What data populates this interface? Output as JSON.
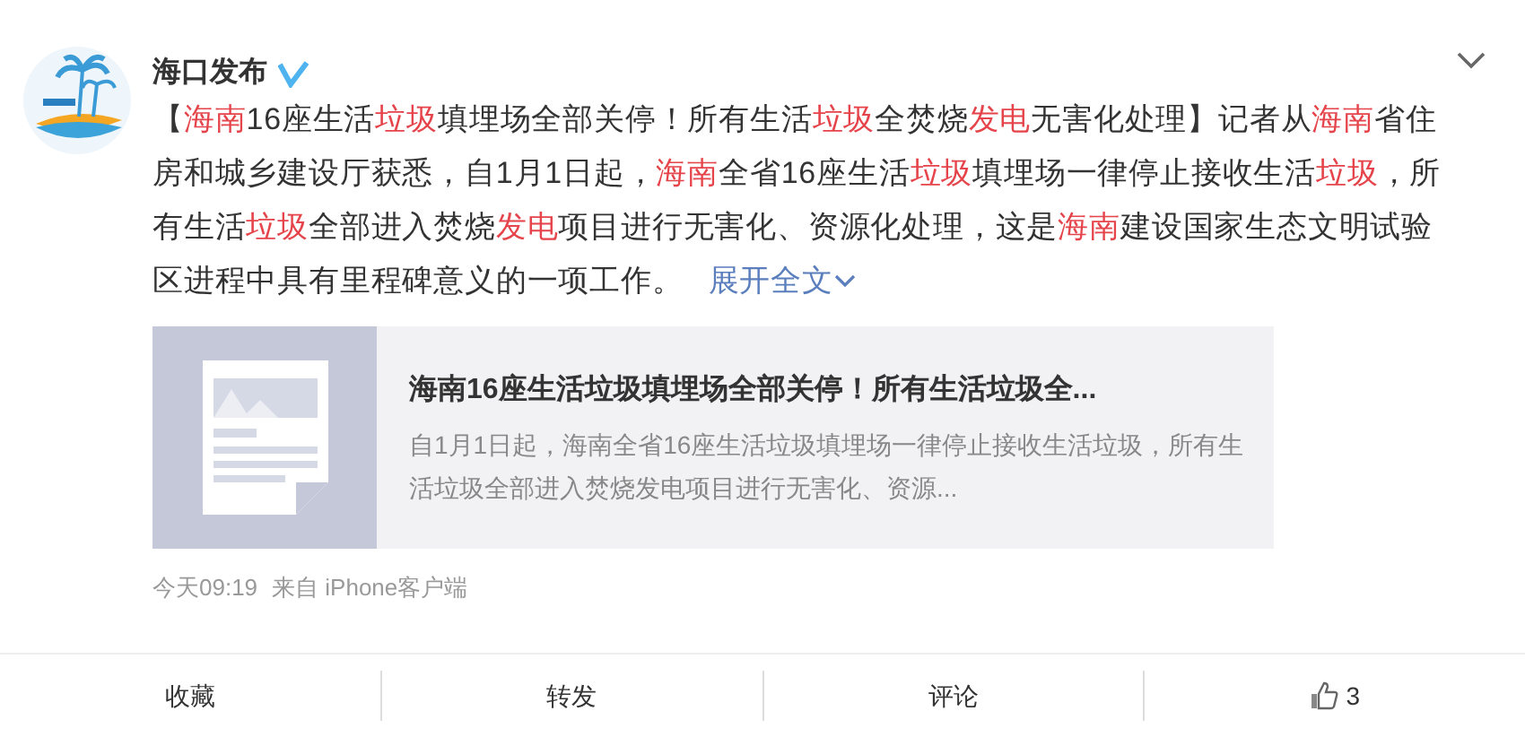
{
  "author": {
    "name": "海口发布",
    "verified": true
  },
  "post": [
    {
      "text": "【",
      "highlight": false
    },
    {
      "text": "海南",
      "highlight": true
    },
    {
      "text": "16座生活",
      "highlight": false
    },
    {
      "text": "垃圾",
      "highlight": true
    },
    {
      "text": "填埋场全部关停！所有生活",
      "highlight": false
    },
    {
      "text": "垃圾",
      "highlight": true
    },
    {
      "text": "全焚烧",
      "highlight": false
    },
    {
      "text": "发电",
      "highlight": true
    },
    {
      "text": "无害化处理】记者从",
      "highlight": false
    },
    {
      "text": "海南",
      "highlight": true
    },
    {
      "text": "省住房和城乡建设厅获悉，自1月1日起，",
      "highlight": false
    },
    {
      "text": "海南",
      "highlight": true
    },
    {
      "text": "全省16座生活",
      "highlight": false
    },
    {
      "text": "垃圾",
      "highlight": true
    },
    {
      "text": "填埋场一律停止接收生活",
      "highlight": false
    },
    {
      "text": "垃圾",
      "highlight": true
    },
    {
      "text": "，所有生活",
      "highlight": false
    },
    {
      "text": "垃圾",
      "highlight": true
    },
    {
      "text": "全部进入焚烧",
      "highlight": false
    },
    {
      "text": "发电",
      "highlight": true
    },
    {
      "text": "项目进行无害化、资源化处理，这是",
      "highlight": false
    },
    {
      "text": "海南",
      "highlight": true
    },
    {
      "text": "建设国家生态文明试验区进程中具有里程碑意义的一项工作。",
      "highlight": false
    }
  ],
  "expand_link": "展开全文",
  "card": {
    "title": "海南16座生活垃圾填埋场全部关停！所有生活垃圾全...",
    "description": "自1月1日起，海南全省16座生活垃圾填埋场一律停止接收生活垃圾，所有生活垃圾全部进入焚烧发电项目进行无害化、资源..."
  },
  "meta": {
    "time": "今天09:19",
    "source": "来自 iPhone客户端"
  },
  "actions": [
    {
      "kind": "text",
      "label": "收藏"
    },
    {
      "kind": "text",
      "label": "转发"
    },
    {
      "kind": "text",
      "label": "评论"
    },
    {
      "kind": "like",
      "label": "3"
    }
  ]
}
